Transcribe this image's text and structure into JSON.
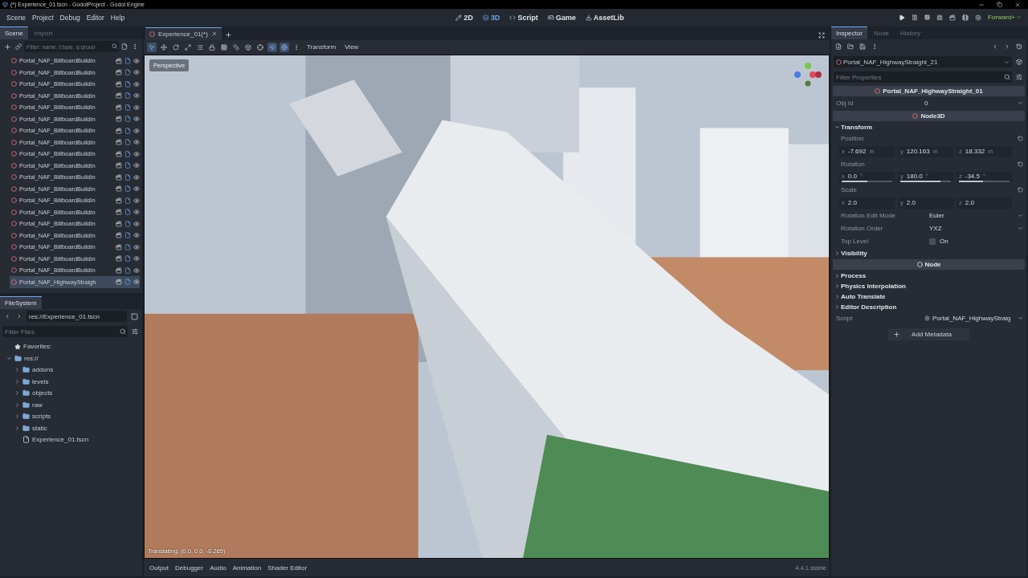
{
  "window": {
    "title": "(*) Experience_01.tscn - GodotProject - Godot Engine"
  },
  "menu": [
    "Scene",
    "Project",
    "Debug",
    "Editor",
    "Help"
  ],
  "workspaces": [
    {
      "label": "2D",
      "selected": false
    },
    {
      "label": "3D",
      "selected": true
    },
    {
      "label": "Script",
      "selected": false
    },
    {
      "label": "Game",
      "selected": false
    },
    {
      "label": "AssetLib",
      "selected": false
    }
  ],
  "renderer": "Forward+",
  "scene_dock": {
    "tabs": [
      {
        "label": "Scene",
        "selected": true
      },
      {
        "label": "Import",
        "selected": false
      }
    ],
    "filter": {
      "placeholder": "Filter: name, t:type, g:group"
    },
    "nodes": [
      {
        "name": "Portal_NAF_BillboardBuildin",
        "selected": false
      },
      {
        "name": "Portal_NAF_BillboardBuildin",
        "selected": false
      },
      {
        "name": "Portal_NAF_BillboardBuildin",
        "selected": false
      },
      {
        "name": "Portal_NAF_BillboardBuildin",
        "selected": false
      },
      {
        "name": "Portal_NAF_BillboardBuildin",
        "selected": false
      },
      {
        "name": "Portal_NAF_BillboardBuildin",
        "selected": false
      },
      {
        "name": "Portal_NAF_BillboardBuildin",
        "selected": false
      },
      {
        "name": "Portal_NAF_BillboardBuildin",
        "selected": false
      },
      {
        "name": "Portal_NAF_BillboardBuildin",
        "selected": false
      },
      {
        "name": "Portal_NAF_BillboardBuildin",
        "selected": false
      },
      {
        "name": "Portal_NAF_BillboardBuildin",
        "selected": false
      },
      {
        "name": "Portal_NAF_BillboardBuildin",
        "selected": false
      },
      {
        "name": "Portal_NAF_BillboardBuildin",
        "selected": false
      },
      {
        "name": "Portal_NAF_BillboardBuildin",
        "selected": false
      },
      {
        "name": "Portal_NAF_BillboardBuildin",
        "selected": false
      },
      {
        "name": "Portal_NAF_BillboardBuildin",
        "selected": false
      },
      {
        "name": "Portal_NAF_BillboardBuildin",
        "selected": false
      },
      {
        "name": "Portal_NAF_BillboardBuildin",
        "selected": false
      },
      {
        "name": "Portal_NAF_BillboardBuildin",
        "selected": false
      },
      {
        "name": "Portal_NAF_HighwayStraigh",
        "selected": true
      }
    ]
  },
  "filesystem": {
    "tab": "FileSystem",
    "path": "res://Experience_01.tscn",
    "filter": {
      "placeholder": "Filter Files"
    },
    "tree": [
      {
        "kind": "favorites",
        "name": "Favorites:"
      },
      {
        "kind": "folder",
        "name": "res://",
        "expanded": true,
        "children": [
          {
            "kind": "folder",
            "name": "addons",
            "expanded": false
          },
          {
            "kind": "folder",
            "name": "levels",
            "expanded": false
          },
          {
            "kind": "folder",
            "name": "objects",
            "expanded": false
          },
          {
            "kind": "folder",
            "name": "raw",
            "expanded": false
          },
          {
            "kind": "folder",
            "name": "scripts",
            "expanded": false
          },
          {
            "kind": "folder",
            "name": "static",
            "expanded": false
          },
          {
            "kind": "file",
            "name": "Experience_01.tscn"
          }
        ]
      }
    ]
  },
  "editor": {
    "tab": "Experience_01(*)",
    "tools": [
      {
        "selected": true
      },
      {
        "selected": false
      },
      {
        "selected": false
      },
      {
        "selected": false
      },
      {
        "selected": false
      },
      {
        "selected": false
      },
      {
        "selected": false
      },
      {
        "selected": false
      },
      {
        "selected": false
      },
      {
        "selected": false
      },
      {
        "selected": true
      },
      {
        "selected": true
      }
    ],
    "menus": [
      "Transform",
      "View"
    ],
    "perspective": "Perspective",
    "status": "Translating: (0.0, 0.0, -0.265)"
  },
  "bottom_panel": {
    "tabs": [
      "Output",
      "Debugger",
      "Audio",
      "Animation",
      "Shader Editor"
    ],
    "version": "4.4.1.stable"
  },
  "inspector": {
    "tabs": [
      {
        "label": "Inspector",
        "selected": true
      },
      {
        "label": "Node",
        "selected": false
      },
      {
        "label": "History",
        "selected": false
      }
    ],
    "node_path": "Portal_NAF_HighwayStraight_21",
    "filter": {
      "placeholder": "Filter Properties"
    },
    "header": "Portal_NAF_HighwayStraight_01",
    "obj_id": {
      "label": "Obj Id",
      "value": "0"
    },
    "sections": [
      {
        "title": "Node3D",
        "groups": [
          {
            "title": "Transform",
            "expanded": true
          }
        ]
      },
      {
        "title": "Node",
        "groups": [
          {
            "title": "Process",
            "expanded": false
          },
          {
            "title": "Physics Interpolation",
            "expanded": false
          },
          {
            "title": "Auto Translate",
            "expanded": false
          },
          {
            "title": "Editor Description",
            "expanded": false
          }
        ]
      }
    ],
    "position": {
      "label": "Position",
      "axes": [
        {
          "axis": "x",
          "value": "-7.692",
          "unit": "m"
        },
        {
          "axis": "y",
          "value": "120.163",
          "unit": "m"
        },
        {
          "axis": "z",
          "value": "18.332",
          "unit": "m"
        }
      ]
    },
    "rotation": {
      "label": "Rotation",
      "axes": [
        {
          "axis": "x",
          "value": "0.0",
          "unit": "°",
          "level": 0.5
        },
        {
          "axis": "y",
          "value": "180.0",
          "unit": "°",
          "level": 0.79
        },
        {
          "axis": "z",
          "value": "-34.5",
          "unit": "°",
          "level": 0.48
        }
      ]
    },
    "scale": {
      "label": "Scale",
      "axes": [
        {
          "axis": "x",
          "value": "2.0"
        },
        {
          "axis": "y",
          "value": "2.0"
        },
        {
          "axis": "z",
          "value": "2.0"
        }
      ]
    },
    "rotation_edit_mode": {
      "label": "Rotation Edit Mode",
      "value": "Euler"
    },
    "rotation_order": {
      "label": "Rotation Order",
      "value": "YXZ"
    },
    "top_level": {
      "label": "Top Level",
      "text": "On",
      "checked": false
    },
    "visibility": {
      "title": "Visibility",
      "expanded": false
    },
    "script": {
      "label": "Script",
      "value": "Portal_NAF_HighwayStraig"
    },
    "add_metadata": "Add Metadata"
  }
}
